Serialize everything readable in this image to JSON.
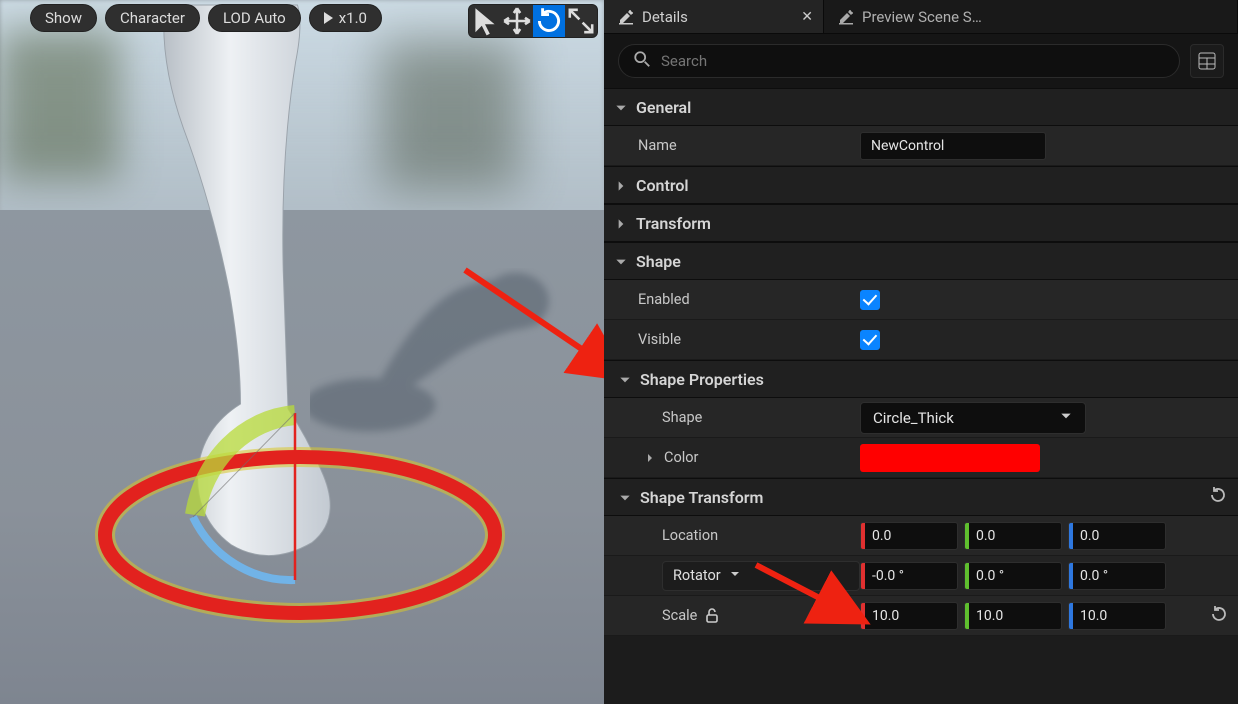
{
  "viewport": {
    "pills": {
      "show": "Show",
      "character": "Character",
      "lod": "LOD Auto",
      "play": "x1.0"
    }
  },
  "tabs": {
    "details": "Details",
    "preview": "Preview Scene S…"
  },
  "search": {
    "placeholder": "Search"
  },
  "general": {
    "title": "General",
    "name_label": "Name",
    "name_value": "NewControl"
  },
  "control": {
    "title": "Control"
  },
  "transform": {
    "title": "Transform"
  },
  "shape": {
    "title": "Shape",
    "enabled_label": "Enabled",
    "visible_label": "Visible",
    "enabled": true,
    "visible": true
  },
  "shape_props": {
    "title": "Shape Properties",
    "shape_label": "Shape",
    "shape_value": "Circle_Thick",
    "color_label": "Color",
    "color_value": "#ff0000"
  },
  "shape_xform": {
    "title": "Shape Transform",
    "location_label": "Location",
    "rotator_label": "Rotator",
    "scale_label": "Scale",
    "location": {
      "x": "0.0",
      "y": "0.0",
      "z": "0.0"
    },
    "rotation": {
      "x": "-0.0 °",
      "y": "0.0 °",
      "z": "0.0 °"
    },
    "scale": {
      "x": "10.0",
      "y": "10.0",
      "z": "10.0"
    }
  }
}
